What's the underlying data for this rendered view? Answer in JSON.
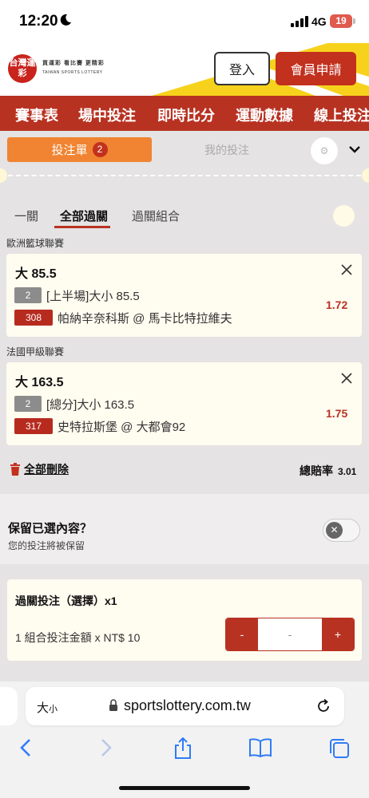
{
  "status_bar": {
    "time": "12:20",
    "network": "4G",
    "battery": "19"
  },
  "header": {
    "logo_text": "台灣運彩",
    "logo_slogan": "買運彩 看比賽 更精彩",
    "logo_english": "TAIWAN SPORTS LOTTERY",
    "login_label": "登入",
    "register_label": "會員申請"
  },
  "nav": {
    "items": [
      "賽事表",
      "場中投注",
      "即時比分",
      "運動數據",
      "線上投注"
    ]
  },
  "betslip": {
    "tab_active_label": "投注單",
    "tab_active_count": "2",
    "tab_inactive_label": "我的投注",
    "sub_tabs": [
      "一關",
      "全部過關",
      "過關組合"
    ],
    "active_sub_tab": "全部過關"
  },
  "bets": [
    {
      "league": "歐洲籃球聯賽",
      "title": "大 85.5",
      "market_num": "2",
      "market": "[上半場]大小 85.5",
      "match_num": "308",
      "match": "帕納辛奈科斯 @ 馬卡比特拉維夫",
      "odds": "1.72"
    },
    {
      "league": "法國甲級聯賽",
      "title": "大 163.5",
      "market_num": "2",
      "market": "[總分]大小 163.5",
      "match_num": "317",
      "match": "史特拉斯堡 @ 大都會92",
      "odds": "1.75"
    }
  ],
  "summary": {
    "delete_all_label": "全部刪除",
    "total_odds_label": "總賠率",
    "total_odds_value": "3.01"
  },
  "keep": {
    "title": "保留已選內容？",
    "subtitle": "您的投注將被保留",
    "toggle_on": false
  },
  "parlay": {
    "title": "過關投注（選擇）x1",
    "amount_label": "1 組合投注金額 x NT$ 10",
    "minus_label": "-",
    "value": "-",
    "plus_label": "+"
  },
  "safari": {
    "aa_label": "大",
    "aa_small": "小",
    "url": "sportslottery.com.tw"
  },
  "colors": {
    "brand_red": "#b83222",
    "orange": "#f08432",
    "card_bg": "#fffcf0"
  },
  "icons": [
    "moon-icon",
    "signal-icon",
    "battery-icon",
    "gear-icon",
    "chevron-down-icon",
    "close-icon",
    "trash-icon",
    "lock-icon",
    "reload-icon",
    "back-icon",
    "forward-icon",
    "share-icon",
    "bookmarks-icon",
    "tabs-icon"
  ]
}
